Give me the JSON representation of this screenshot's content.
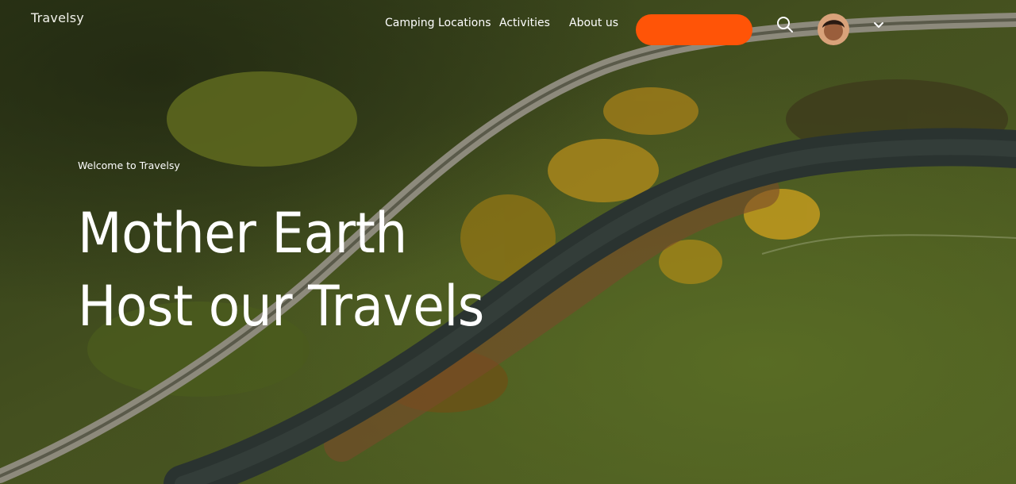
{
  "brand": {
    "logo_text": "Travelsy"
  },
  "nav": {
    "links": [
      {
        "label": "Camping Locations"
      },
      {
        "label": "Activities"
      },
      {
        "label": "About us"
      }
    ],
    "cta_label": "",
    "search_icon": "search-icon",
    "avatar_icon": "avatar",
    "menu_icon": "chevron-down-icon"
  },
  "hero": {
    "eyebrow": "Welcome to Travelsy",
    "headline_line1": "Mother Earth",
    "headline_line2": "Host our Travels"
  },
  "colors": {
    "accent": "#ff5407",
    "text": "#ffffff"
  }
}
